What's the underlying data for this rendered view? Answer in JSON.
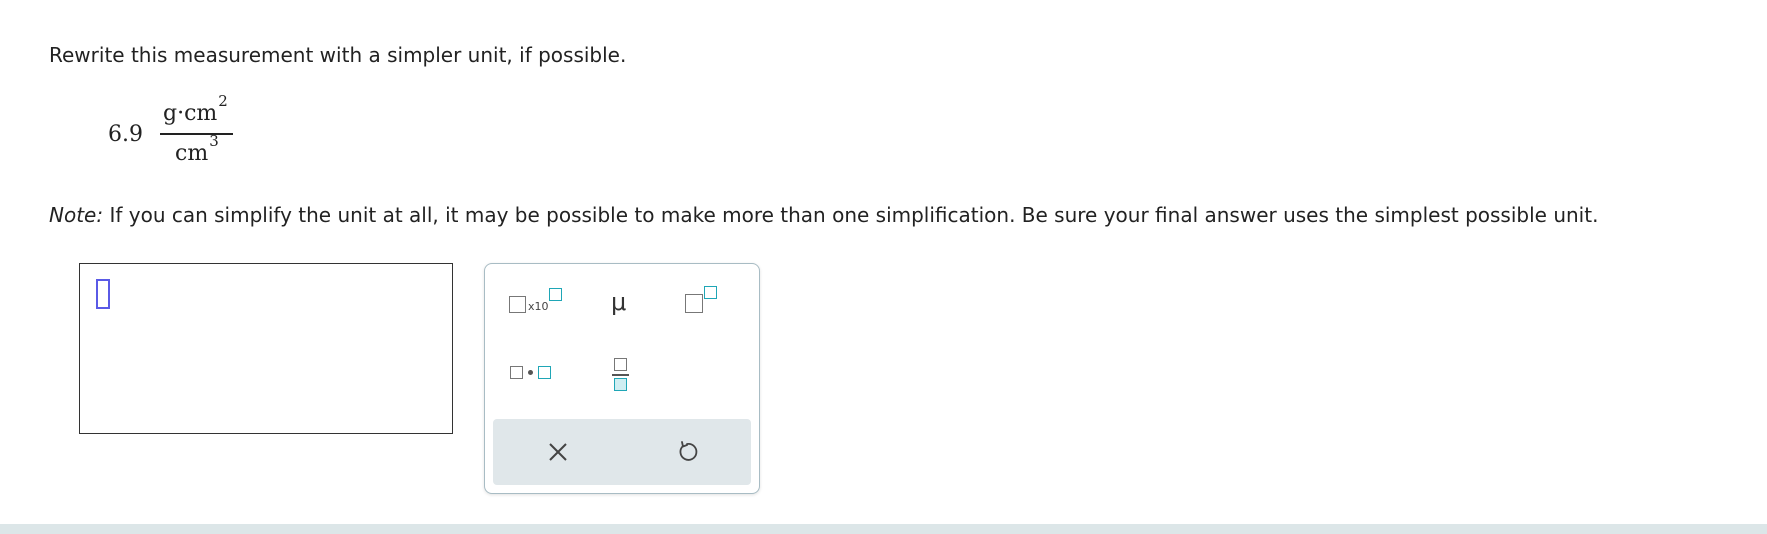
{
  "question": {
    "prompt": "Rewrite this measurement with a simpler unit, if possible.",
    "measurement": {
      "coefficient": "6.9",
      "numerator_units": "g·cm",
      "numerator_exponent": "2",
      "denominator_units": "cm",
      "denominator_exponent": "3"
    },
    "note_label": "Note:",
    "note_text": " If you can simplify the unit at all, it may be possible to make more than one simplification. Be sure your final answer uses the simplest possible unit."
  },
  "answer": {
    "value": ""
  },
  "palette": {
    "x10_label": "x10",
    "mu_label": "μ",
    "icons": {
      "sci_notation": "scientific-notation-icon",
      "mu": "mu-symbol-icon",
      "superscript": "superscript-icon",
      "multiply": "multiply-dot-icon",
      "fraction": "fraction-icon",
      "clear": "close-icon",
      "reset": "undo-icon"
    }
  },
  "colors": {
    "accent_teal": "#1fa6b6",
    "cursor_blue": "#5a5ae6",
    "action_bar": "#e0e7ea"
  }
}
